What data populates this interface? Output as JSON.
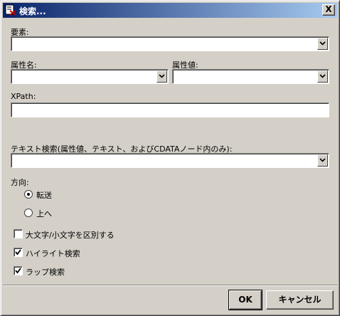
{
  "window": {
    "title": "検索...",
    "close_glyph": "X"
  },
  "fields": {
    "element_label": "要素:",
    "element_value": "",
    "attr_name_label": "属性名:",
    "attr_name_value": "",
    "attr_value_label": "属性値:",
    "attr_value_value": "",
    "xpath_label": "XPath:",
    "xpath_value": "",
    "text_search_label": "テキスト検索(属性値、テキスト、およびCDATAノード内のみ):",
    "text_search_value": ""
  },
  "direction": {
    "label": "方向:",
    "options": [
      {
        "label": "転送",
        "selected": true
      },
      {
        "label": "上へ",
        "selected": false
      }
    ]
  },
  "options": [
    {
      "label": "大文字/小文字を区別する",
      "checked": false
    },
    {
      "label": "ハイライト検索",
      "checked": true
    },
    {
      "label": "ラップ検索",
      "checked": true
    }
  ],
  "buttons": {
    "ok": "OK",
    "cancel": "キャンセル"
  },
  "colors": {
    "titlebar_start": "#0a246a",
    "titlebar_end": "#a6caf0",
    "dialog_bg": "#d4d0c8"
  }
}
